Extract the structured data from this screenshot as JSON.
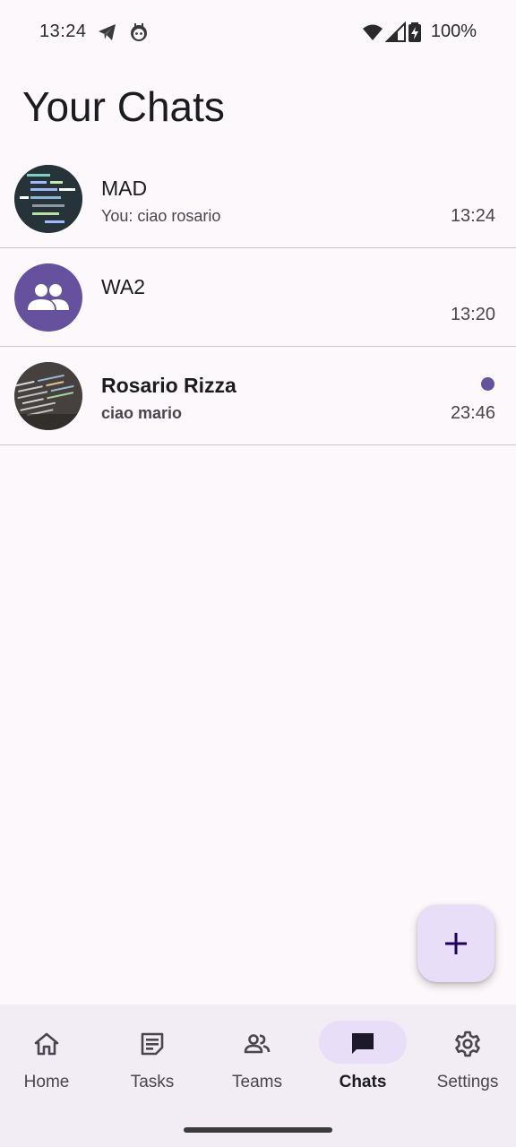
{
  "status_bar": {
    "time": "13:24",
    "battery": "100%",
    "icons": [
      "telegram-icon",
      "android-robot-icon",
      "wifi-icon",
      "signal-icon",
      "battery-charging-icon"
    ]
  },
  "page": {
    "title": "Your Chats"
  },
  "chats": [
    {
      "name": "MAD",
      "preview": "You: ciao rosario",
      "time": "13:24",
      "avatar": "code-photo-avatar",
      "unread": false
    },
    {
      "name": "WA2",
      "preview": "",
      "time": "13:20",
      "avatar": "group-icon",
      "unread": false
    },
    {
      "name": "Rosario Rizza",
      "preview": "ciao mario",
      "time": "23:46",
      "avatar": "code-photo-avatar",
      "unread": true
    }
  ],
  "fab": {
    "icon": "plus-icon"
  },
  "bottom_nav": {
    "items": [
      {
        "label": "Home",
        "icon": "home-icon",
        "active": false
      },
      {
        "label": "Tasks",
        "icon": "tasks-icon",
        "active": false
      },
      {
        "label": "Teams",
        "icon": "people-icon",
        "active": false
      },
      {
        "label": "Chats",
        "icon": "chat-bubble-icon",
        "active": true
      },
      {
        "label": "Settings",
        "icon": "gear-icon",
        "active": false
      }
    ]
  },
  "colors": {
    "background": "#fdf8fc",
    "accent": "#65519e",
    "active_indicator": "#e8def8",
    "nav_background": "#f2ecf4"
  }
}
